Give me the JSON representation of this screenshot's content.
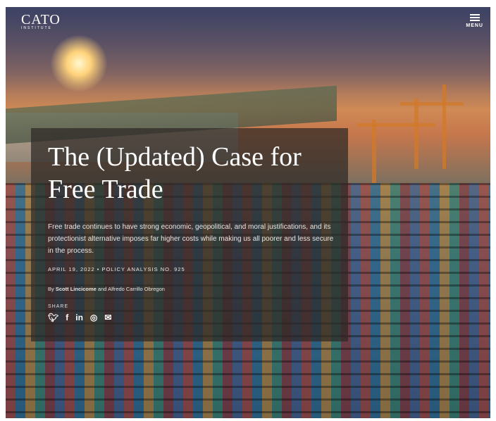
{
  "header": {
    "logo_text": "CATO",
    "logo_subtext": "INSTITUTE",
    "menu_label": "MENU"
  },
  "article": {
    "title": "The (Updated) Case for Free Trade",
    "summary": "Free trade continues to have strong economic, geopolitical, and moral justifications, and its protectionist alternative imposes far higher costs while making us all poorer and less secure in the process.",
    "date_and_type": "APRIL 19, 2022 • POLICY ANALYSIS NO. 925",
    "byline_prefix": "By",
    "author_1": "Scott Lincicome",
    "byline_conjunction": "and",
    "author_2": "Alfredo Carrillo Obregon",
    "share_label": "SHARE"
  },
  "share_icons": [
    "twitter-icon",
    "facebook-icon",
    "linkedin-icon",
    "reddit-icon",
    "email-icon"
  ]
}
